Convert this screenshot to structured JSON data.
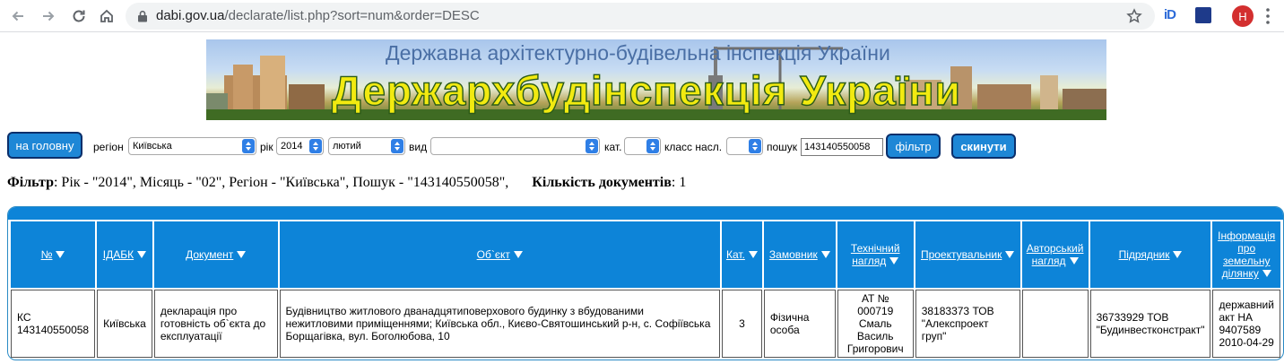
{
  "browser": {
    "url_host": "dabi.gov.ua",
    "url_path": "/declarate/list.php?sort=num&order=DESC",
    "avatar_letter": "H",
    "extension_label": "iD"
  },
  "banner": {
    "subtitle": "Державна архітектурно-будівельна інспекція України",
    "title": "Держархбудінспекція України"
  },
  "filters": {
    "home_button": "на головну",
    "region_label": "регіон",
    "region_value": "Київська",
    "year_label": "рік",
    "year_value": "2014",
    "month_value": "лютий",
    "type_label": "вид",
    "type_value": "",
    "category_label": "кат.",
    "category_value": "",
    "class_label": "класс насл.",
    "class_value": "",
    "search_label": "пошук",
    "search_value": "143140550058",
    "filter_button": "фільтр",
    "reset_button": "скинути"
  },
  "summary": {
    "filter_label": "Фільтр",
    "filter_text": ": Рік - \"2014\", Місяць - \"02\", Регіон - \"Київська\", Пошук - \"143140550058\",",
    "count_label": "Кількість документів",
    "count_value": ": 1"
  },
  "table": {
    "columns": [
      "№",
      "ІДАБК",
      "Документ",
      "Об`єкт",
      "Кат.",
      "Замовник",
      "Технічний нагляд",
      "Проектувальник",
      "Авторський нагляд",
      "Підрядник",
      "Інформація про земельну ділянку"
    ],
    "rows": [
      [
        "КС 143140550058",
        "Київська",
        "декларація про готовність об`єкта до експлуатації",
        "Будівництво житлового дванадцятиповерхового будинку з вбудованими нежитловими приміщеннями; Київська обл., Києво-Святошинський р-н, с. Софіївська Борщагівка, вул. Боголюбова, 10",
        "3",
        "Фізична особа",
        "АТ № 000719 Смаль Василь Григорович",
        "38183373 ТОВ \"Алекспроект груп\"",
        "",
        "36733929 ТОВ \"Будинвестконстракт\"",
        "державний акт НА 9407589 2010-04-29"
      ]
    ]
  },
  "colors": {
    "header_blue": "#0d84d8",
    "button_blue": "#1e87d6",
    "button_border": "#0b2f6b"
  }
}
